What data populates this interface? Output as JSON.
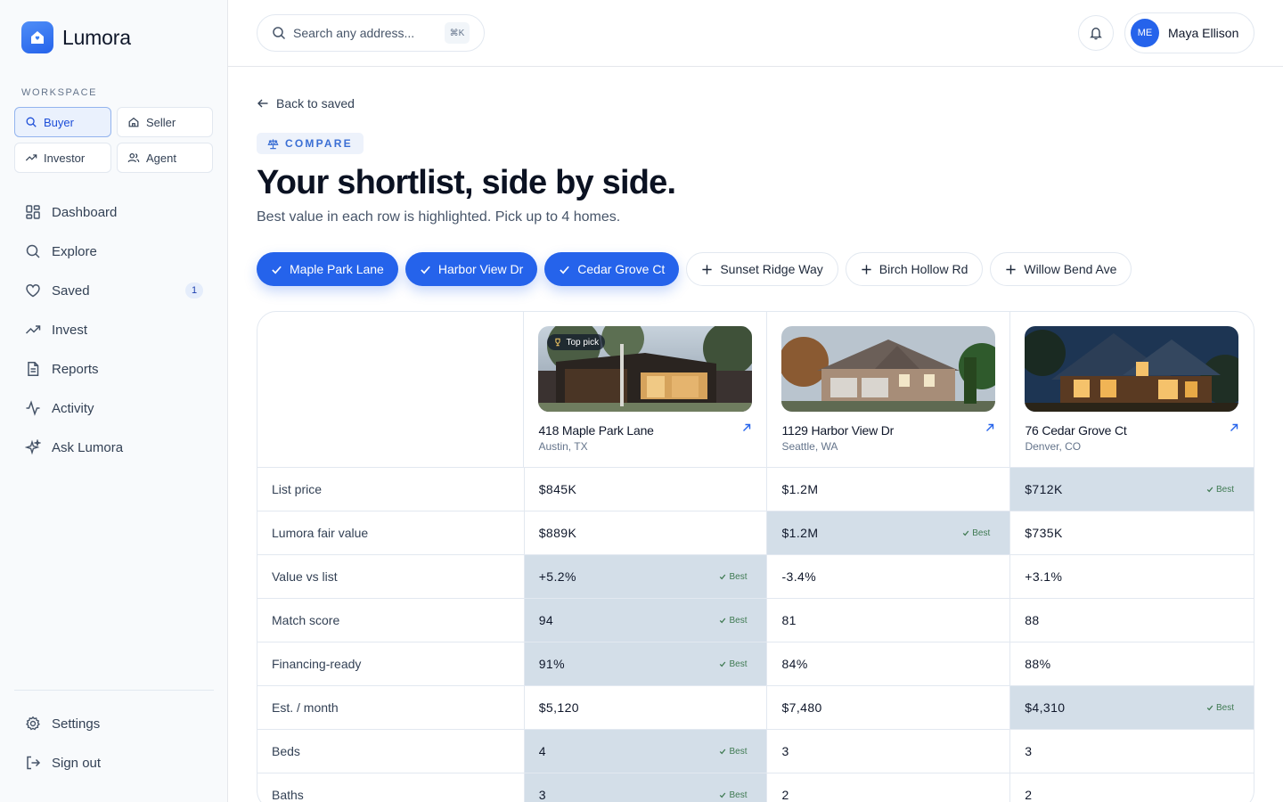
{
  "app": {
    "name": "Lumora"
  },
  "workspace": {
    "label": "WORKSPACE",
    "modes": [
      {
        "label": "Buyer",
        "icon": "search-icon",
        "active": true
      },
      {
        "label": "Seller",
        "icon": "home-icon",
        "active": false
      },
      {
        "label": "Investor",
        "icon": "trend-up-icon",
        "active": false
      },
      {
        "label": "Agent",
        "icon": "users-icon",
        "active": false
      }
    ]
  },
  "nav": {
    "items": [
      {
        "label": "Dashboard",
        "icon": "grid-icon"
      },
      {
        "label": "Explore",
        "icon": "search-icon"
      },
      {
        "label": "Saved",
        "icon": "heart-icon",
        "badge": "1"
      },
      {
        "label": "Invest",
        "icon": "trend-up-icon"
      },
      {
        "label": "Reports",
        "icon": "document-icon"
      },
      {
        "label": "Activity",
        "icon": "pulse-icon"
      },
      {
        "label": "Ask Lumora",
        "icon": "sparkles-icon"
      }
    ],
    "bottom": [
      {
        "label": "Settings",
        "icon": "gear-icon"
      },
      {
        "label": "Sign out",
        "icon": "sign-out-icon"
      }
    ]
  },
  "topbar": {
    "search_placeholder": "Search any address...",
    "shortcut": "⌘K",
    "user": {
      "initials": "ME",
      "name": "Maya Ellison"
    }
  },
  "page": {
    "back_label": "Back to saved",
    "kicker": "COMPARE",
    "title": "Your shortlist, side by side.",
    "subtitle": "Best value in each row is highlighted. Pick up to 4 homes."
  },
  "chips": [
    {
      "label": "Maple Park Lane",
      "selected": true
    },
    {
      "label": "Harbor View Dr",
      "selected": true
    },
    {
      "label": "Cedar Grove Ct",
      "selected": true
    },
    {
      "label": "Sunset Ridge Way",
      "selected": false
    },
    {
      "label": "Birch Hollow Rd",
      "selected": false
    },
    {
      "label": "Willow Bend Ave",
      "selected": false
    }
  ],
  "homes": [
    {
      "address": "418 Maple Park Lane",
      "city": "Austin, TX",
      "badge": "Top pick"
    },
    {
      "address": "1129 Harbor View Dr",
      "city": "Seattle, WA"
    },
    {
      "address": "76 Cedar Grove Ct",
      "city": "Denver, CO"
    }
  ],
  "best_label": "Best",
  "rows": [
    {
      "label": "List price",
      "values": [
        "$845K",
        "$1.2M",
        "$712K"
      ],
      "best": 2
    },
    {
      "label": "Lumora fair value",
      "values": [
        "$889K",
        "$1.2M",
        "$735K"
      ],
      "best": 1
    },
    {
      "label": "Value vs list",
      "values": [
        "+5.2%",
        "-3.4%",
        "+3.1%"
      ],
      "best": 0
    },
    {
      "label": "Match score",
      "values": [
        "94",
        "81",
        "88"
      ],
      "best": 0
    },
    {
      "label": "Financing-ready",
      "values": [
        "91%",
        "84%",
        "88%"
      ],
      "best": 0
    },
    {
      "label": "Est. / month",
      "values": [
        "$5,120",
        "$7,480",
        "$4,310"
      ],
      "best": 2
    },
    {
      "label": "Beds",
      "values": [
        "4",
        "3",
        "3"
      ],
      "best": 0
    },
    {
      "label": "Baths",
      "values": [
        "3",
        "2",
        "2"
      ],
      "best": 0
    }
  ],
  "colors": {
    "accent": "#2563eb",
    "best_cell": "#d3dee8",
    "best_text": "#3f7a52"
  }
}
